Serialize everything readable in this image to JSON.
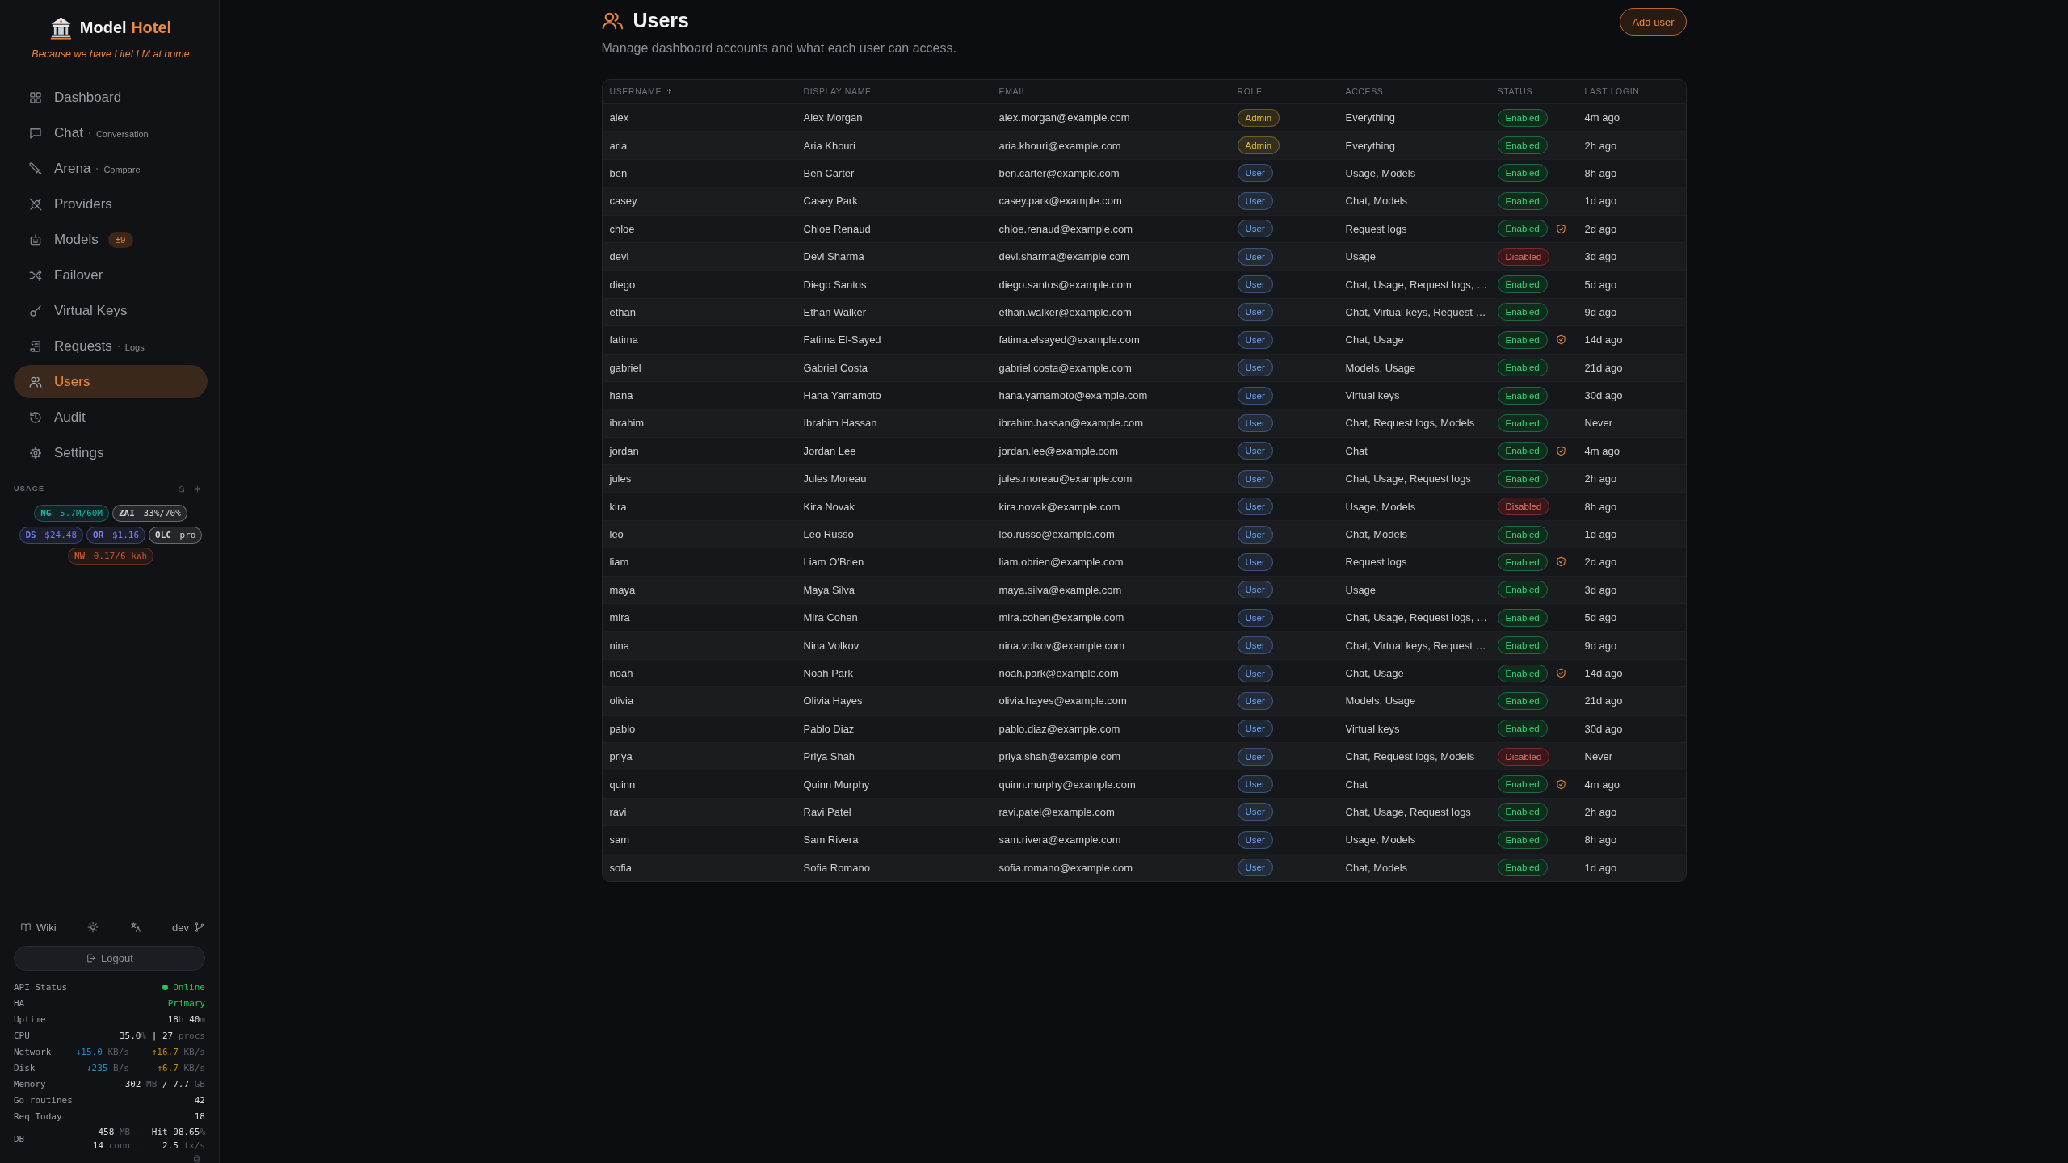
{
  "sidebar": {
    "brand": {
      "name": "Model",
      "accent": "Hotel",
      "tagline": "Because we have LiteLLM at home"
    },
    "nav": [
      {
        "label": "Dashboard",
        "selected": false
      },
      {
        "label": "Chat",
        "sub": "Conversation",
        "selected": false
      },
      {
        "label": "Arena",
        "sub": "Compare",
        "selected": false
      },
      {
        "label": "Providers",
        "selected": false
      },
      {
        "label": "Models",
        "badge": "±9",
        "selected": false
      },
      {
        "label": "Failover",
        "selected": false
      },
      {
        "label": "Virtual Keys",
        "selected": false
      },
      {
        "label": "Requests",
        "sub": "Logs",
        "selected": false
      },
      {
        "label": "Users",
        "selected": true
      },
      {
        "label": "Audit",
        "selected": false
      },
      {
        "label": "Settings",
        "selected": false
      }
    ],
    "usage": {
      "title": "USAGE",
      "chips": [
        {
          "label": "NG",
          "value": "5.7M/60M",
          "color": "#22b3ab"
        },
        {
          "label": "ZAI",
          "value": "33%/70%",
          "color": "#d4d4d8"
        },
        {
          "label": "DS",
          "value": "$24.48",
          "color": "#6b7cf0"
        },
        {
          "label": "OR",
          "value": "$1.16",
          "color": "#7b80e6"
        },
        {
          "label": "OLC",
          "value": "pro",
          "color": "#d4d4d8"
        },
        {
          "label": "NW",
          "value": "0.17/6 kWh",
          "color": "#c4532e"
        }
      ]
    },
    "tools": {
      "wiki": "Wiki",
      "branch": "dev",
      "logout": "Logout"
    },
    "status": [
      {
        "label": "API Status",
        "dot": true,
        "values": [
          [
            {
              "text": "Online",
              "kind": "green"
            }
          ]
        ]
      },
      {
        "label": "HA",
        "values": [
          [
            {
              "text": "Primary",
              "kind": "green"
            }
          ]
        ]
      },
      {
        "label": "Uptime",
        "values": [
          [
            {
              "text": "18",
              "kind": "bright"
            },
            {
              "text": "h ",
              "kind": "dim"
            },
            {
              "text": "40",
              "kind": "bright"
            },
            {
              "text": "m",
              "kind": "dim"
            }
          ]
        ]
      },
      {
        "label": "CPU",
        "values": [
          [
            {
              "text": "35.0",
              "kind": "bright"
            },
            {
              "text": "% ",
              "kind": "dim"
            },
            {
              "text": "| 27 ",
              "kind": "bright"
            },
            {
              "text": "procs",
              "kind": "dim"
            }
          ]
        ]
      },
      {
        "label": "Network",
        "values": [
          [
            {
              "text": "↓15.0",
              "kind": "down"
            },
            {
              "text": " KB/s",
              "kind": "dim"
            }
          ],
          [
            {
              "text": "↑16.7",
              "kind": "up"
            },
            {
              "text": " KB/s",
              "kind": "dim"
            }
          ]
        ]
      },
      {
        "label": "Disk",
        "values": [
          [
            {
              "text": "↓235",
              "kind": "down"
            },
            {
              "text": " B/s",
              "kind": "dim"
            }
          ],
          [
            {
              "text": "↑6.7",
              "kind": "up"
            },
            {
              "text": " KB/s",
              "kind": "dim"
            }
          ]
        ]
      },
      {
        "label": "Memory",
        "values": [
          [
            {
              "text": "302",
              "kind": "bright"
            },
            {
              "text": " MB ",
              "kind": "dim"
            },
            {
              "text": "/ 7.7",
              "kind": "bright"
            },
            {
              "text": " GB",
              "kind": "dim"
            }
          ]
        ]
      },
      {
        "label": "Go routines",
        "values": [
          [
            {
              "text": "42",
              "kind": "bright"
            }
          ]
        ]
      },
      {
        "label": "Req Today",
        "values": [
          [
            {
              "text": "18",
              "kind": "bright"
            }
          ]
        ]
      },
      {
        "label": "DB",
        "lines": [
          {
            "left": [
              {
                "text": "458",
                "kind": "bright"
              },
              {
                "text": " MB",
                "kind": "dim"
              }
            ],
            "sep": "|",
            "right": [
              {
                "text": "Hit 98.65",
                "kind": "bright"
              },
              {
                "text": "%",
                "kind": "dim"
              }
            ]
          },
          {
            "left": [
              {
                "text": "14",
                "kind": "bright"
              },
              {
                "text": " conn",
                "kind": "dim"
              }
            ],
            "sep": "|",
            "right": [
              {
                "text": "2.5",
                "kind": "bright"
              },
              {
                "text": " tx/s",
                "kind": "dim"
              }
            ]
          }
        ]
      }
    ]
  },
  "page": {
    "title": "Users",
    "subtitle": "Manage dashboard accounts and what each user can access.",
    "add_button": "Add user"
  },
  "table": {
    "columns": [
      {
        "label": "USERNAME",
        "sorted": true
      },
      {
        "label": "DISPLAY NAME",
        "sorted": false
      },
      {
        "label": "EMAIL",
        "sorted": false
      },
      {
        "label": "ROLE",
        "sorted": false
      },
      {
        "label": "ACCESS",
        "sorted": false
      },
      {
        "label": "STATUS",
        "sorted": false
      },
      {
        "label": "LAST LOGIN",
        "sorted": false
      }
    ],
    "rows": [
      {
        "username": "alex",
        "display_name": "Alex Morgan",
        "email": "alex.morgan@example.com",
        "role": {
          "label": "Admin",
          "color": "#e3bf2a"
        },
        "access": "Everything",
        "status": "Enabled",
        "enabled": true,
        "shield": false,
        "last_login": "4m ago"
      },
      {
        "username": "aria",
        "display_name": "Aria Khouri",
        "email": "aria.khouri@example.com",
        "role": {
          "label": "Admin",
          "color": "#e3bf2a"
        },
        "access": "Everything",
        "status": "Enabled",
        "enabled": true,
        "shield": false,
        "last_login": "2h ago"
      },
      {
        "username": "ben",
        "display_name": "Ben Carter",
        "email": "ben.carter@example.com",
        "role": {
          "label": "User",
          "color": "#6ea6f4"
        },
        "access": "Usage, Models",
        "status": "Enabled",
        "enabled": true,
        "shield": false,
        "last_login": "8h ago"
      },
      {
        "username": "casey",
        "display_name": "Casey Park",
        "email": "casey.park@example.com",
        "role": {
          "label": "User",
          "color": "#6ea6f4"
        },
        "access": "Chat, Models",
        "status": "Enabled",
        "enabled": true,
        "shield": false,
        "last_login": "1d ago"
      },
      {
        "username": "chloe",
        "display_name": "Chloe Renaud",
        "email": "chloe.renaud@example.com",
        "role": {
          "label": "User",
          "color": "#6ea6f4"
        },
        "access": "Request logs",
        "status": "Enabled",
        "enabled": true,
        "shield": true,
        "last_login": "2d ago"
      },
      {
        "username": "devi",
        "display_name": "Devi Sharma",
        "email": "devi.sharma@example.com",
        "role": {
          "label": "User",
          "color": "#6ea6f4"
        },
        "access": "Usage",
        "status": "Disabled",
        "enabled": false,
        "shield": false,
        "last_login": "3d ago"
      },
      {
        "username": "diego",
        "display_name": "Diego Santos",
        "email": "diego.santos@example.com",
        "role": {
          "label": "User",
          "color": "#6ea6f4"
        },
        "access": "Chat, Usage, Request logs, …",
        "status": "Enabled",
        "enabled": true,
        "shield": false,
        "last_login": "5d ago"
      },
      {
        "username": "ethan",
        "display_name": "Ethan Walker",
        "email": "ethan.walker@example.com",
        "role": {
          "label": "User",
          "color": "#6ea6f4"
        },
        "access": "Chat, Virtual keys, Request …",
        "status": "Enabled",
        "enabled": true,
        "shield": false,
        "last_login": "9d ago"
      },
      {
        "username": "fatima",
        "display_name": "Fatima El-Sayed",
        "email": "fatima.elsayed@example.com",
        "role": {
          "label": "User",
          "color": "#6ea6f4"
        },
        "access": "Chat, Usage",
        "status": "Enabled",
        "enabled": true,
        "shield": true,
        "last_login": "14d ago"
      },
      {
        "username": "gabriel",
        "display_name": "Gabriel Costa",
        "email": "gabriel.costa@example.com",
        "role": {
          "label": "User",
          "color": "#6ea6f4"
        },
        "access": "Models, Usage",
        "status": "Enabled",
        "enabled": true,
        "shield": false,
        "last_login": "21d ago"
      },
      {
        "username": "hana",
        "display_name": "Hana Yamamoto",
        "email": "hana.yamamoto@example.com",
        "role": {
          "label": "User",
          "color": "#6ea6f4"
        },
        "access": "Virtual keys",
        "status": "Enabled",
        "enabled": true,
        "shield": false,
        "last_login": "30d ago"
      },
      {
        "username": "ibrahim",
        "display_name": "Ibrahim Hassan",
        "email": "ibrahim.hassan@example.com",
        "role": {
          "label": "User",
          "color": "#6ea6f4"
        },
        "access": "Chat, Request logs, Models",
        "status": "Enabled",
        "enabled": true,
        "shield": false,
        "last_login": "Never"
      },
      {
        "username": "jordan",
        "display_name": "Jordan Lee",
        "email": "jordan.lee@example.com",
        "role": {
          "label": "User",
          "color": "#6ea6f4"
        },
        "access": "Chat",
        "status": "Enabled",
        "enabled": true,
        "shield": true,
        "last_login": "4m ago"
      },
      {
        "username": "jules",
        "display_name": "Jules Moreau",
        "email": "jules.moreau@example.com",
        "role": {
          "label": "User",
          "color": "#6ea6f4"
        },
        "access": "Chat, Usage, Request logs",
        "status": "Enabled",
        "enabled": true,
        "shield": false,
        "last_login": "2h ago"
      },
      {
        "username": "kira",
        "display_name": "Kira Novak",
        "email": "kira.novak@example.com",
        "role": {
          "label": "User",
          "color": "#6ea6f4"
        },
        "access": "Usage, Models",
        "status": "Disabled",
        "enabled": false,
        "shield": false,
        "last_login": "8h ago"
      },
      {
        "username": "leo",
        "display_name": "Leo Russo",
        "email": "leo.russo@example.com",
        "role": {
          "label": "User",
          "color": "#6ea6f4"
        },
        "access": "Chat, Models",
        "status": "Enabled",
        "enabled": true,
        "shield": false,
        "last_login": "1d ago"
      },
      {
        "username": "liam",
        "display_name": "Liam O'Brien",
        "email": "liam.obrien@example.com",
        "role": {
          "label": "User",
          "color": "#6ea6f4"
        },
        "access": "Request logs",
        "status": "Enabled",
        "enabled": true,
        "shield": true,
        "last_login": "2d ago"
      },
      {
        "username": "maya",
        "display_name": "Maya Silva",
        "email": "maya.silva@example.com",
        "role": {
          "label": "User",
          "color": "#6ea6f4"
        },
        "access": "Usage",
        "status": "Enabled",
        "enabled": true,
        "shield": false,
        "last_login": "3d ago"
      },
      {
        "username": "mira",
        "display_name": "Mira Cohen",
        "email": "mira.cohen@example.com",
        "role": {
          "label": "User",
          "color": "#6ea6f4"
        },
        "access": "Chat, Usage, Request logs, …",
        "status": "Enabled",
        "enabled": true,
        "shield": false,
        "last_login": "5d ago"
      },
      {
        "username": "nina",
        "display_name": "Nina Volkov",
        "email": "nina.volkov@example.com",
        "role": {
          "label": "User",
          "color": "#6ea6f4"
        },
        "access": "Chat, Virtual keys, Request …",
        "status": "Enabled",
        "enabled": true,
        "shield": false,
        "last_login": "9d ago"
      },
      {
        "username": "noah",
        "display_name": "Noah Park",
        "email": "noah.park@example.com",
        "role": {
          "label": "User",
          "color": "#6ea6f4"
        },
        "access": "Chat, Usage",
        "status": "Enabled",
        "enabled": true,
        "shield": true,
        "last_login": "14d ago"
      },
      {
        "username": "olivia",
        "display_name": "Olivia Hayes",
        "email": "olivia.hayes@example.com",
        "role": {
          "label": "User",
          "color": "#6ea6f4"
        },
        "access": "Models, Usage",
        "status": "Enabled",
        "enabled": true,
        "shield": false,
        "last_login": "21d ago"
      },
      {
        "username": "pablo",
        "display_name": "Pablo Diaz",
        "email": "pablo.diaz@example.com",
        "role": {
          "label": "User",
          "color": "#6ea6f4"
        },
        "access": "Virtual keys",
        "status": "Enabled",
        "enabled": true,
        "shield": false,
        "last_login": "30d ago"
      },
      {
        "username": "priya",
        "display_name": "Priya Shah",
        "email": "priya.shah@example.com",
        "role": {
          "label": "User",
          "color": "#6ea6f4"
        },
        "access": "Chat, Request logs, Models",
        "status": "Disabled",
        "enabled": false,
        "shield": false,
        "last_login": "Never"
      },
      {
        "username": "quinn",
        "display_name": "Quinn Murphy",
        "email": "quinn.murphy@example.com",
        "role": {
          "label": "User",
          "color": "#6ea6f4"
        },
        "access": "Chat",
        "status": "Enabled",
        "enabled": true,
        "shield": true,
        "last_login": "4m ago"
      },
      {
        "username": "ravi",
        "display_name": "Ravi Patel",
        "email": "ravi.patel@example.com",
        "role": {
          "label": "User",
          "color": "#6ea6f4"
        },
        "access": "Chat, Usage, Request logs",
        "status": "Enabled",
        "enabled": true,
        "shield": false,
        "last_login": "2h ago"
      },
      {
        "username": "sam",
        "display_name": "Sam Rivera",
        "email": "sam.rivera@example.com",
        "role": {
          "label": "User",
          "color": "#6ea6f4"
        },
        "access": "Usage, Models",
        "status": "Enabled",
        "enabled": true,
        "shield": false,
        "last_login": "8h ago"
      },
      {
        "username": "sofia",
        "display_name": "Sofia Romano",
        "email": "sofia.romano@example.com",
        "role": {
          "label": "User",
          "color": "#6ea6f4"
        },
        "access": "Chat, Models",
        "status": "Enabled",
        "enabled": true,
        "shield": false,
        "last_login": "1d ago"
      }
    ]
  }
}
